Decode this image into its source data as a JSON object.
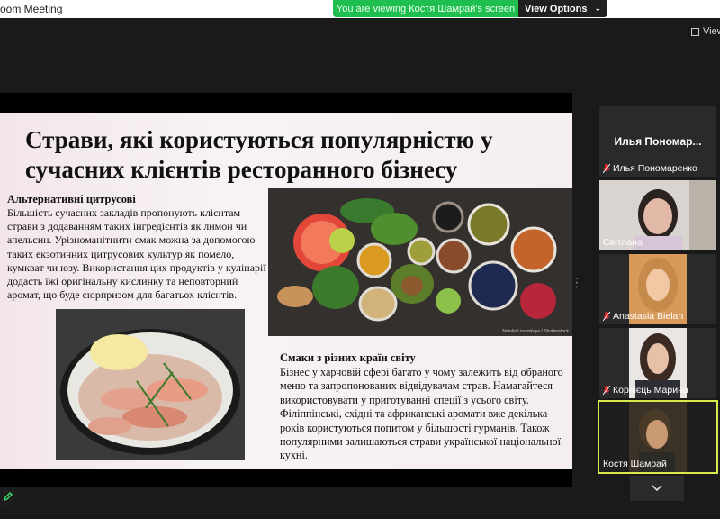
{
  "window": {
    "title": "oom Meeting"
  },
  "banner": {
    "viewing_text": "You are viewing Костя Шамрай's screen",
    "view_options": "View Options",
    "chev": "⌄"
  },
  "view_button": {
    "label": "View"
  },
  "slide": {
    "title": "Страви, які користуються популярністю у сучасних клієнтів ресторанного бізнесу",
    "left_heading": "Альтернативні цитрусові",
    "left_text": "Більшість сучасних закладів пропонують клієнтам страви з додаванням таких інгредієнтів як лимон чи апельсин. Урізноманітнити смак можна за допомогою таких екзотичних цитрусових культур як помело, кумкват чи юзу. Використання цих продуктів у кулінарії додасть їжі оригінальну кислинку та неповторний аромат, що буде сюрпризом для багатьох клієнтів.",
    "right_heading": "Смаки з різних країн світу",
    "right_text": "Бізнес у харчовій сфері багато у чому залежить від обраного меню та запропонованих відвідувачам страв. Намагайтеся використовувати у приготуванні спеції з усього світу. Філіппінські, східні та африканські аромати вже декілька років користуються попитом у більшості гурманів. Також популярними залишаються страви української національної кухні.",
    "image_credit": "Natalia Lisovskaya / Shutterstock"
  },
  "participants": [
    {
      "big_name": "Илья  Пономар...",
      "name": "Илья Пономаренко",
      "muted": true
    },
    {
      "name": "Світлана",
      "muted": false
    },
    {
      "name": "Anastasia Bielan",
      "muted": true
    },
    {
      "name": "Корнієць Марина",
      "muted": true
    },
    {
      "name": "Костя Шамрай",
      "muted": false,
      "active": true
    }
  ],
  "colors": {
    "accent_green": "#1fbf4f",
    "active_border": "#d9e84a",
    "mute_red": "#e02a2a"
  },
  "icons": {
    "mic_muted": "muted-mic-icon",
    "chevron_down": "chevron-down-icon",
    "pencil": "pencil-icon",
    "grid": "grid-view-icon"
  }
}
